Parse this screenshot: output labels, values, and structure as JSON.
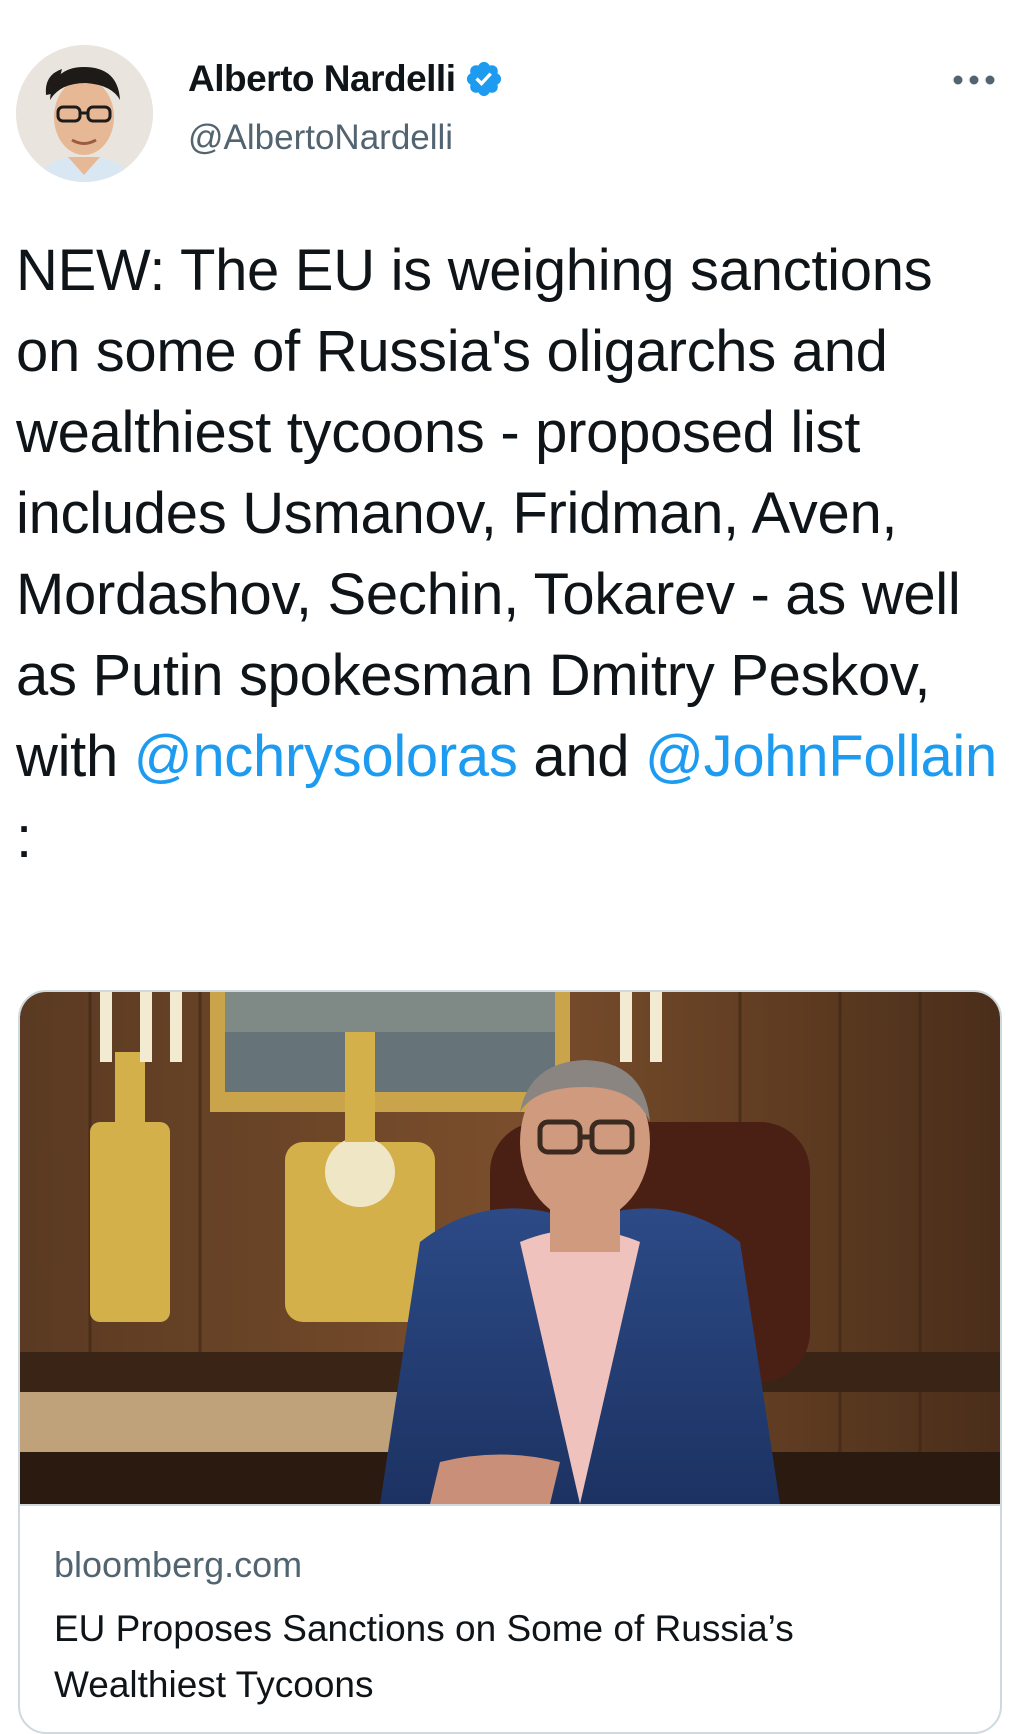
{
  "author": {
    "display_name": "Alberto Nardelli",
    "handle": "@AlbertoNardelli",
    "verified": true,
    "avatar_icon": "avatar-photo"
  },
  "tweet": {
    "text_before_mention_1": "NEW: The EU is weighing sanctions on some of Russia's oligarchs and wealthiest tycoons - proposed list includes Usmanov, Fridman, Aven, Mordashov, Sechin, Tokarev - as well as Putin spokesman Dmitry Peskov, with ",
    "mention_1": "@nchrysoloras",
    "text_between_mentions": " and ",
    "mention_2": "@JohnFollain",
    "text_after_mention_2": " :"
  },
  "link_card": {
    "domain": "bloomberg.com",
    "title": "EU Proposes Sanctions on Some of Russia’s Wealthiest Tycoons",
    "image_icon": "article-photo"
  },
  "colors": {
    "text": "#0f1419",
    "secondary": "#536471",
    "accent": "#1d9bf0",
    "border": "#cfd9de"
  },
  "icons": {
    "verified": "verified-badge-icon",
    "more": "more-options-icon"
  }
}
